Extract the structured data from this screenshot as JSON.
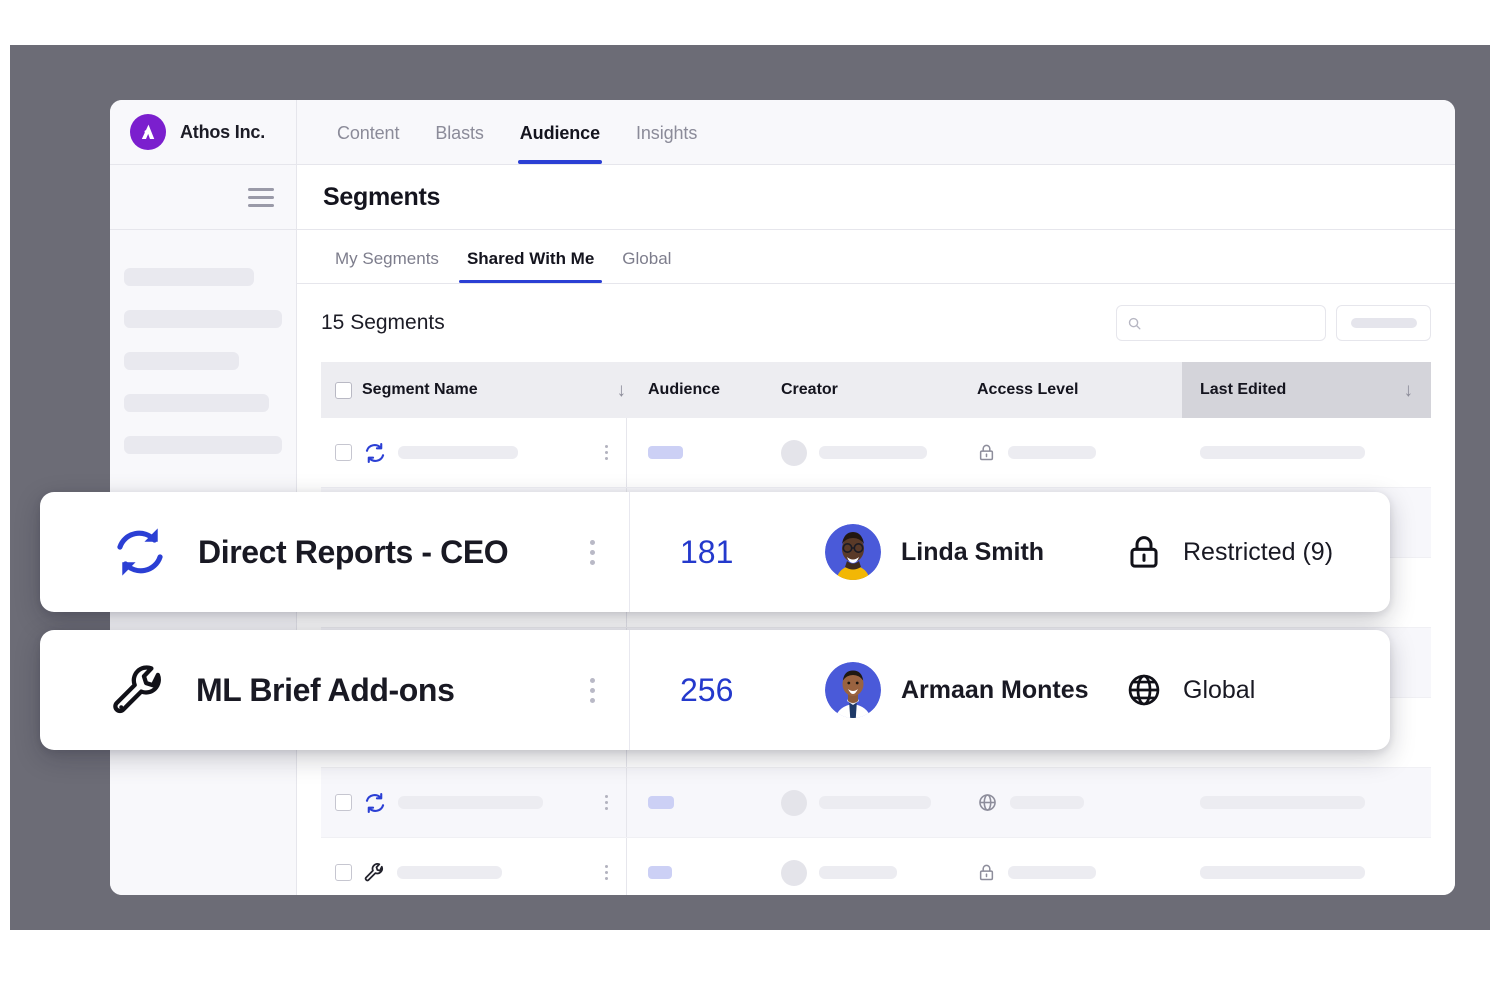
{
  "brand": {
    "name": "Athos Inc.",
    "logo_color": "#7B1FCE",
    "logo_icon": "athos-logo-icon"
  },
  "nav": {
    "tabs": [
      {
        "label": "Content",
        "active": false
      },
      {
        "label": "Blasts",
        "active": false
      },
      {
        "label": "Audience",
        "active": true
      },
      {
        "label": "Insights",
        "active": false
      }
    ],
    "accent": "#2b3fd4"
  },
  "page": {
    "title": "Segments"
  },
  "subtabs": [
    {
      "label": "My Segments",
      "active": false
    },
    {
      "label": "Shared With Me",
      "active": true
    },
    {
      "label": "Global",
      "active": false
    }
  ],
  "toolbar": {
    "count_label": "15 Segments",
    "search_placeholder": "",
    "search_value": "",
    "search_icon": "search-icon",
    "button_label": ""
  },
  "table": {
    "columns": [
      {
        "label": "Segment Name",
        "sortable": true
      },
      {
        "label": "Audience",
        "sortable": false
      },
      {
        "label": "Creator",
        "sortable": false
      },
      {
        "label": "Access Level",
        "sortable": false
      },
      {
        "label": "Last Edited",
        "sortable": true,
        "highlighted": true
      }
    ],
    "sort_arrow": "↓",
    "skeleton_rows": [
      {
        "type_icon": "sync-icon",
        "access_icon": "lock-icon",
        "shaded": false
      },
      {
        "type_icon": "sync-icon",
        "access_icon": "globe-icon",
        "shaded": true
      },
      {
        "type_icon": "wrench-icon",
        "access_icon": "lock-icon",
        "shaded": false
      }
    ]
  },
  "highlight_cards": [
    {
      "type_icon": "sync-icon",
      "type_icon_color": "#2b3fd4",
      "name": "Direct Reports - CEO",
      "audience": "181",
      "creator": "Linda Smith",
      "avatar": "avatar-linda-smith",
      "access_icon": "lock-icon",
      "access_level": "Restricted (9)"
    },
    {
      "type_icon": "wrench-icon",
      "type_icon_color": "#111118",
      "name": "ML Brief Add-ons",
      "audience": "256",
      "creator": "Armaan Montes",
      "avatar": "avatar-armaan-montes",
      "access_icon": "globe-icon",
      "access_level": "Global"
    }
  ],
  "colors": {
    "accent_blue": "#2b3fd4",
    "number_blue": "#2439cc",
    "brand_purple": "#7B1FCE",
    "frame_gray": "#6c6c76",
    "header_gray": "#ededf1",
    "header_highlight_gray": "#d4d4da"
  }
}
